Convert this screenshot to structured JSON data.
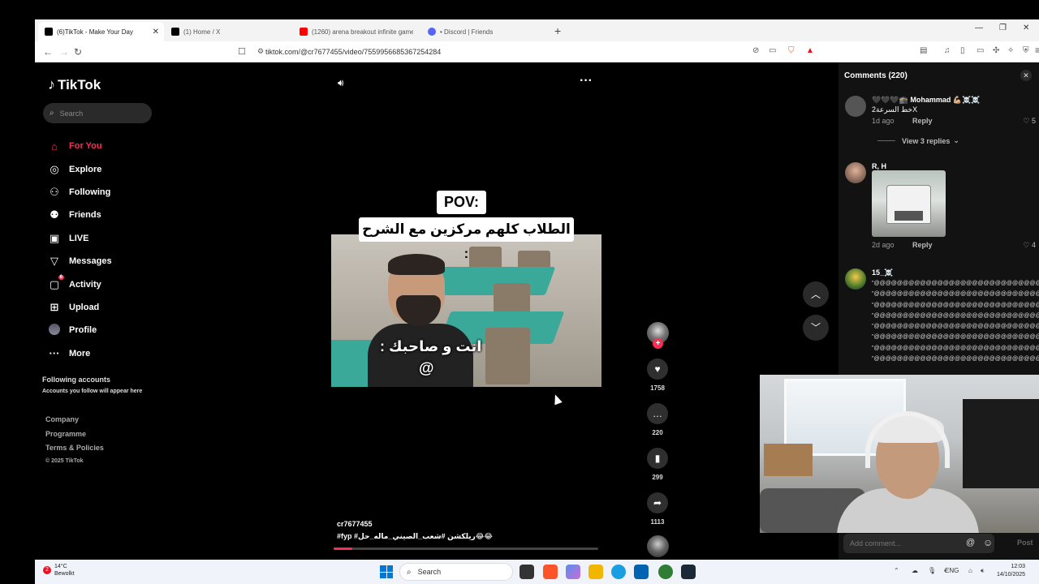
{
  "browser": {
    "tabs": [
      {
        "title": "(6)TikTok - Make Your Day",
        "color": "#000000",
        "active": true
      },
      {
        "title": "(1) Home / X",
        "color": "#000000",
        "active": false
      },
      {
        "title": "(1260) arena breakout infinite gameplay",
        "color": "#ff0000",
        "active": false
      },
      {
        "title": "• Discord | Friends",
        "color": "#5865f2",
        "active": false
      }
    ],
    "url": "tiktok.com/@cr7677455/video/7559956685367254284"
  },
  "sidebar": {
    "brand": "TikTok",
    "search_placeholder": "Search",
    "items": [
      {
        "label": "For You",
        "icon": "home-icon",
        "glyph": "⌂"
      },
      {
        "label": "Explore",
        "icon": "compass-icon",
        "glyph": "◎"
      },
      {
        "label": "Following",
        "icon": "following-icon",
        "glyph": "⚇"
      },
      {
        "label": "Friends",
        "icon": "friends-icon",
        "glyph": "⚉"
      },
      {
        "label": "LIVE",
        "icon": "live-icon",
        "glyph": "▣"
      },
      {
        "label": "Messages",
        "icon": "messages-icon",
        "glyph": "▽"
      },
      {
        "label": "Activity",
        "icon": "activity-icon",
        "glyph": "▢",
        "badge": "6"
      },
      {
        "label": "Upload",
        "icon": "upload-icon",
        "glyph": "⊞"
      },
      {
        "label": "Profile",
        "icon": "profile-icon",
        "glyph": ""
      },
      {
        "label": "More",
        "icon": "more-icon",
        "glyph": "···"
      }
    ],
    "following_title": "Following accounts",
    "following_sub": "Accounts you follow will appear here",
    "footer": [
      "Company",
      "Programme",
      "Terms & Policies"
    ],
    "copyright": "© 2025 TikTok"
  },
  "video": {
    "pov": "POV:",
    "caption": "الطلاب كلهم مركزين مع الشرح :",
    "overlay_line1": "انت و صاحبك :",
    "overlay_line2": "@",
    "author": "cr7677455",
    "tags": "#fyp #ريلكشن #شعب_الصيني_ماله_حل😂😂",
    "progress": 0.07,
    "likes": "1758",
    "comments": "220",
    "saves": "299",
    "shares": "1113"
  },
  "comments": {
    "title": "Comments (220)",
    "list": [
      {
        "name": "🖤🖤🖤🕋 Mohammad 💪🏼☠️☠️",
        "text": "خط السرعة2X",
        "date": "1d ago",
        "reply": "Reply",
        "likes": "5",
        "view_replies": "View 3 replies"
      },
      {
        "name": "R, H",
        "date": "2d ago",
        "reply": "Reply",
        "likes": "4"
      },
      {
        "name": "15_☠️",
        "text": "\"@@@@@@@@@@@@@@@@@@@@@@@@@@@@@@@@\"\n\"@@@@@@@@@@@@@@@@@@@@@@@@@@@@@@@@\"\n\"@@@@@@@@@@@@@@@@@@@@@@@@@@@@@@@@\"\n\"@@@@@@@@@@@@@@@@@@@@@@@@@@@@@@@@\"\n\"@@@@@@@@@@@@@@@@@@@@@@@@@@@@@@@@\"\n\"@@@@@@@@@@@@@@@@@@@@@@@@@@@@@@@@\"\n\"@@@@@@@@@@@@@@@@@@@@@@@@@@@@@@@@\"\n\"@@@@@@@@@@@@@@@@@@@@@@@@@@@@@@@@\""
      }
    ],
    "add_placeholder": "Add comment...",
    "post": "Post"
  },
  "taskbar": {
    "weather_temp": "14°C",
    "weather_desc": "Bewolkt",
    "weather_badge": "2",
    "search": "Search",
    "lang": "ENG",
    "time": "12:03",
    "date": "14/10/2025"
  }
}
